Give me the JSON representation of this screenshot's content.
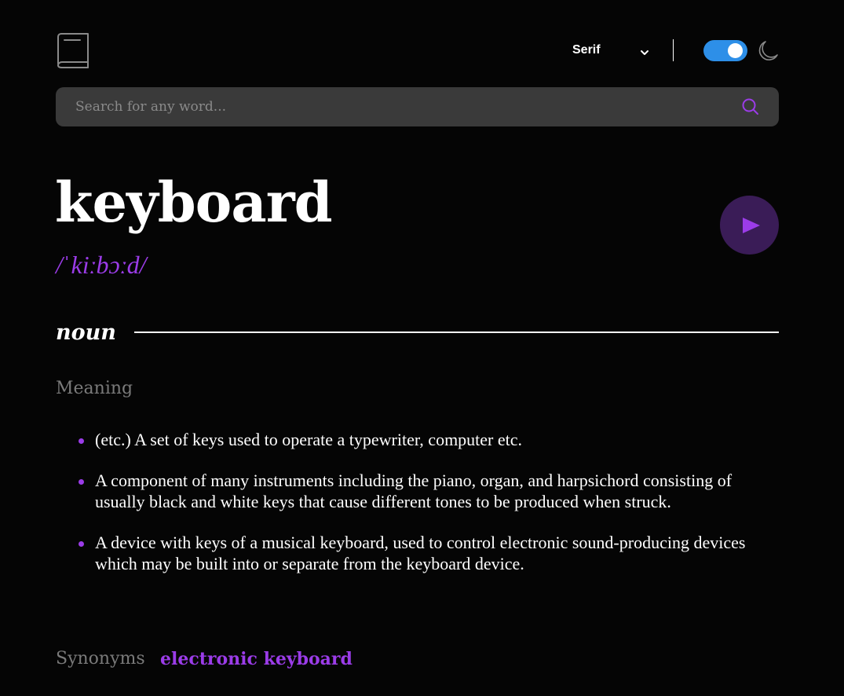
{
  "header": {
    "logo_icon": "book-icon",
    "font_select": {
      "value": "Serif",
      "icon": "chevron-down-icon"
    },
    "theme_toggle": {
      "state": "on",
      "color": "#2d8fe8"
    },
    "theme_icon": "moon-icon"
  },
  "search": {
    "placeholder": "Search for any word...",
    "value": "",
    "icon": "search-icon"
  },
  "entry": {
    "word": "keyboard",
    "phonetic": "/ˈkiːbɔːd/",
    "play_icon": "play-icon",
    "part_of_speech": "noun",
    "meaning_heading": "Meaning",
    "definitions": [
      {
        "text": "(etc.) A set of keys used to operate a typewriter, computer etc."
      },
      {
        "text": "A component of many instruments including the piano, organ, and harpsichord consisting of usually black and white keys that cause different tones to be produced when struck."
      },
      {
        "text": "A device with keys of a musical keyboard, used to control electronic sound-producing devices which may be built into or separate from the keyboard device."
      }
    ],
    "synonyms_label": "Synonyms",
    "synonyms": [
      "electronic keyboard"
    ]
  },
  "colors": {
    "background": "#050505",
    "accent": "#9b3ce8",
    "play_bg": "#3a1c57",
    "search_bg": "#3a3a3a",
    "muted_text": "#7a7a7a"
  }
}
